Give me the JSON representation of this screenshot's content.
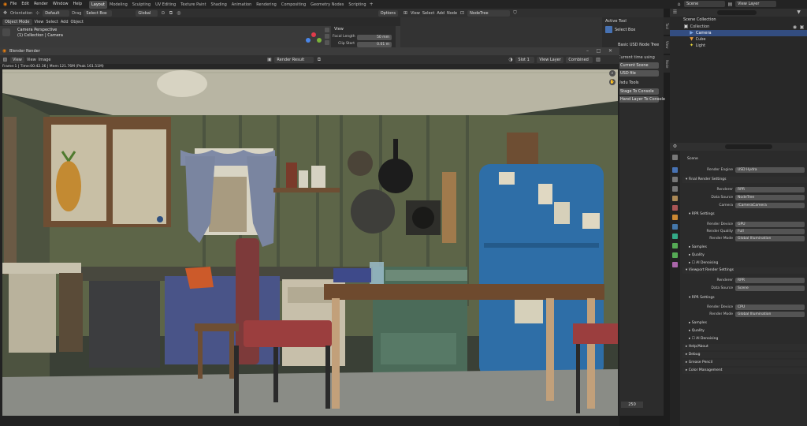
{
  "menu": {
    "items": [
      "File",
      "Edit",
      "Render",
      "Window",
      "Help"
    ]
  },
  "workspaces": {
    "tabs": [
      "Layout",
      "Modeling",
      "Sculpting",
      "UV Editing",
      "Texture Paint",
      "Shading",
      "Animation",
      "Rendering",
      "Compositing",
      "Geometry Nodes",
      "Scripting"
    ],
    "active": "Layout"
  },
  "scene_selector": {
    "value": "Scene"
  },
  "viewlayer_selector": {
    "value": "View Layer"
  },
  "toolbar": {
    "orientation_label": "Orientation",
    "orientation_value": "Default",
    "drag_label": "Drag",
    "drag_value": "Select Box",
    "transform": "Global",
    "options": "Options"
  },
  "viewport": {
    "mode": "Object Mode",
    "menus": [
      "View",
      "Select",
      "Add",
      "Object"
    ],
    "camera_text": "Camera Perspective",
    "collection_text": "(1) Collection | Camera"
  },
  "view_panel": {
    "title": "View",
    "focal_length": "Focal Length",
    "focal_value": "50 mm",
    "clip_start": "Clip Start",
    "clip_value": "0.01 m"
  },
  "node_editor": {
    "menus": [
      "View",
      "Select",
      "Add",
      "Node"
    ],
    "tree": "NodeTree",
    "active_tool": "Active Tool",
    "select_box": "Select Box",
    "usd_title": "Basic USD Node Tree",
    "line1": "Current time using",
    "btn1": "Current Scene",
    "btn2": "USD file",
    "tools_title": "Usdu Tools",
    "btn3": "Stage To Console",
    "btn4": "Hand Layer To Console",
    "tab_tool": "Tool",
    "tab_view": "View",
    "tab_node": "Node",
    "frame": "250"
  },
  "render_window": {
    "title": "Blender Render",
    "menus": [
      "View",
      "View",
      "Image"
    ],
    "image_name": "Render Result",
    "slot": "Slot 1",
    "layer": "View Layer",
    "pass": "Combined",
    "status": "Frame:1 | Time:00:42.36 | Mem:121.76M (Peak 161.51M)"
  },
  "outliner": {
    "title": "Scene Collection",
    "items": [
      "Collection",
      "Camera",
      "Cube",
      "Light"
    ]
  },
  "properties": {
    "scene_label": "Scene",
    "render_engine_label": "Render Engine",
    "render_engine_value": "USD Hydra",
    "final_render": "Final Render Settings",
    "renderer_label": "Renderer",
    "renderer_value": "RPR",
    "data_source_label": "Data Source",
    "data_source_value": "NodeTree",
    "camera_label": "Camera",
    "camera_value": "/CameraCamera",
    "rpr_settings": "RPR Settings",
    "render_device_label": "Render Device",
    "render_device_value": "GPU",
    "render_quality_label": "Render Quality",
    "render_quality_value": "Full",
    "render_mode_label": "Render Mode",
    "render_mode_value": "Global Illumination",
    "samples": "Samples",
    "quality": "Quality",
    "ai_denoising": "AI Denoising",
    "viewport_render": "Viewport Render Settings",
    "vp_renderer_value": "RPR",
    "vp_data_source_value": "Scene",
    "vp_rpr_settings": "RPR Settings",
    "vp_device_value": "CPU",
    "vp_mode_value": "Global Illumination",
    "vp_samples": "Samples",
    "vp_quality": "Quality",
    "vp_denoise": "AI Denoising",
    "sections": [
      "Help/About",
      "Debug",
      "Grease Pencil",
      "Color Management"
    ]
  },
  "colors": {
    "accent": "#4772b3",
    "selected_row": "#334d80",
    "header": "#303030",
    "panel": "#2b2b2b"
  }
}
